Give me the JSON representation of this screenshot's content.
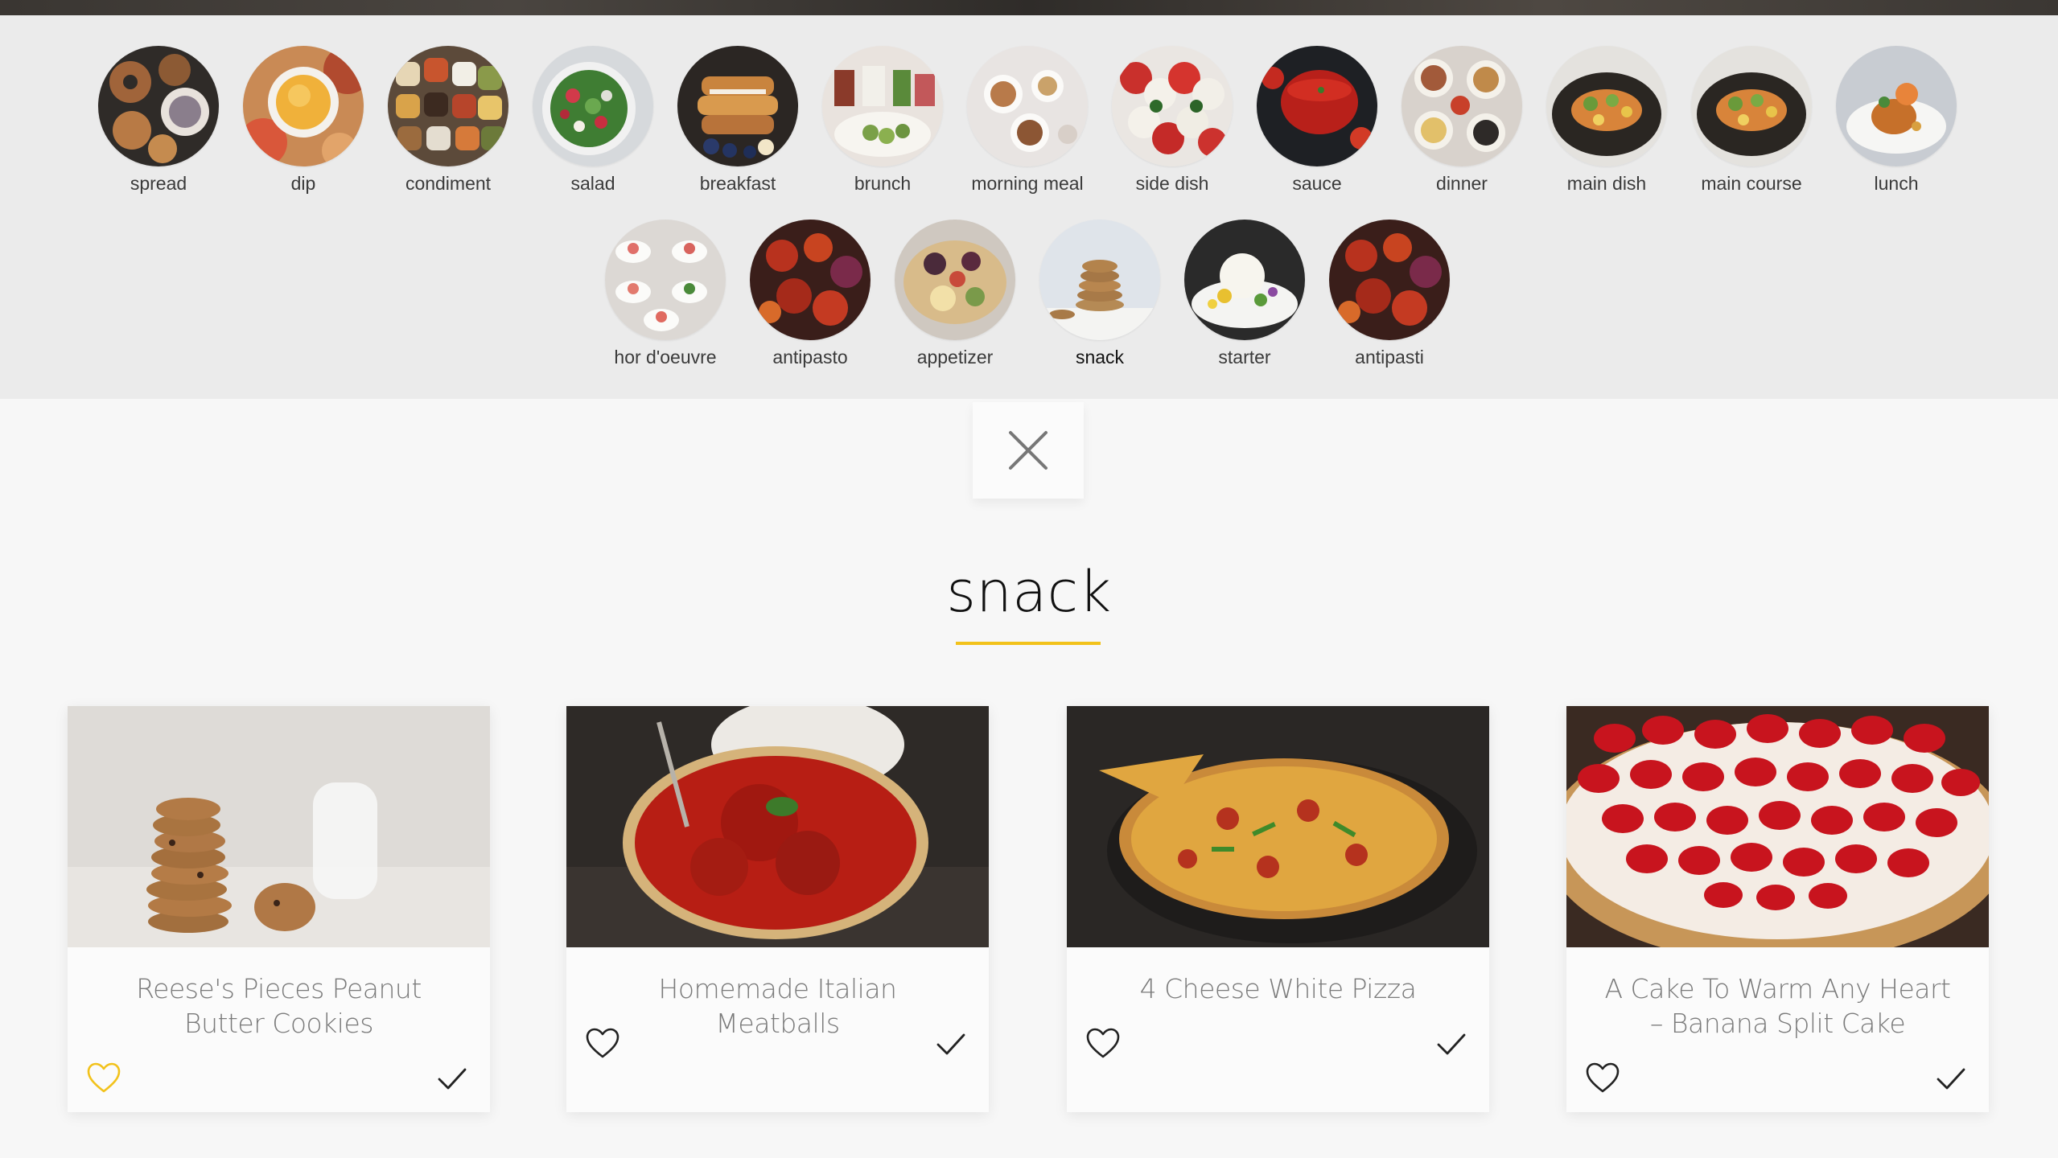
{
  "categories_row1": [
    {
      "label": "spread",
      "icon": "spread-photo"
    },
    {
      "label": "dip",
      "icon": "dip-photo"
    },
    {
      "label": "condiment",
      "icon": "condiment-photo"
    },
    {
      "label": "salad",
      "icon": "salad-photo"
    },
    {
      "label": "breakfast",
      "icon": "breakfast-photo"
    },
    {
      "label": "brunch",
      "icon": "brunch-photo"
    },
    {
      "label": "morning meal",
      "icon": "morning-meal-photo"
    },
    {
      "label": "side dish",
      "icon": "side-dish-photo"
    },
    {
      "label": "sauce",
      "icon": "sauce-photo"
    },
    {
      "label": "dinner",
      "icon": "dinner-photo"
    },
    {
      "label": "main dish",
      "icon": "main-dish-photo"
    },
    {
      "label": "main course",
      "icon": "main-course-photo"
    },
    {
      "label": "lunch",
      "icon": "lunch-photo"
    }
  ],
  "categories_row2": [
    {
      "label": "hor d'oeuvre",
      "icon": "hor-doeuvre-photo"
    },
    {
      "label": "antipasto",
      "icon": "antipasto-photo"
    },
    {
      "label": "appetizer",
      "icon": "appetizer-photo"
    },
    {
      "label": "snack",
      "icon": "snack-photo"
    },
    {
      "label": "starter",
      "icon": "starter-photo"
    },
    {
      "label": "antipasti",
      "icon": "antipasti-photo"
    }
  ],
  "active_category": "snack",
  "section": {
    "title": "snack"
  },
  "colors": {
    "accent": "#f2c21b",
    "favorite_active": "#f2c21b",
    "icon_default": "#222222"
  },
  "recipes": [
    {
      "title": "Reese's Pieces Peanut Butter Cookies",
      "favorited": true,
      "image": "cookies-photo"
    },
    {
      "title": "Homemade Italian Meatballs",
      "favorited": false,
      "image": "meatballs-photo"
    },
    {
      "title": "4 Cheese White Pizza",
      "favorited": false,
      "image": "pizza-photo"
    },
    {
      "title": "A Cake To Warm Any Heart – Banana Split Cake",
      "favorited": false,
      "image": "strawberry-cake-photo"
    }
  ]
}
